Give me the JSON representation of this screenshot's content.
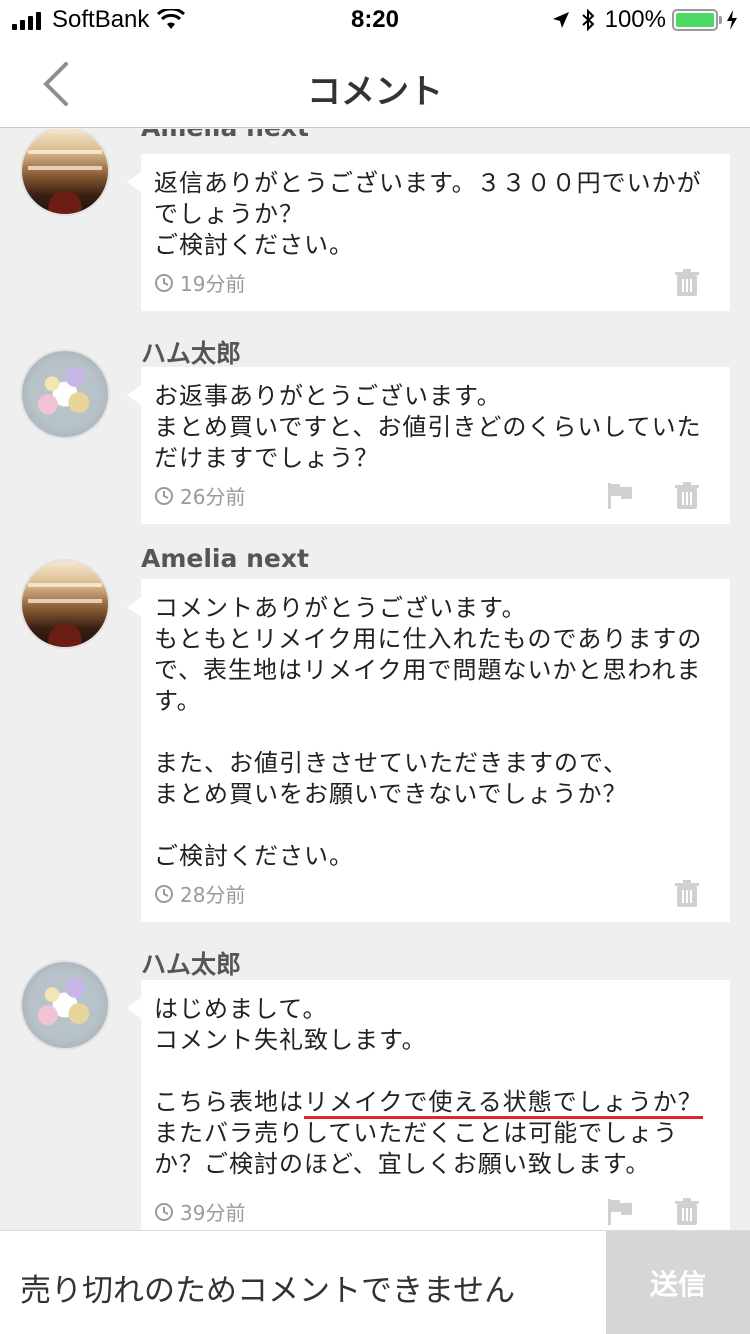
{
  "status_bar": {
    "carrier": "SoftBank",
    "time": "8:20",
    "battery": "100%"
  },
  "nav": {
    "title": "コメント"
  },
  "comments": [
    {
      "author": "Amelia next",
      "avatar": "store-interior",
      "body": "返信ありがとうございます。３３００円でいかがでしょうか？\nご検討ください。",
      "time": "19分前",
      "has_flag": false
    },
    {
      "author": "ハム太郎",
      "avatar": "flower-bouquet",
      "body": "お返事ありがとうございます。\nまとめ買いですと、お値引きどのくらいしていただけますでしょう？",
      "time": "26分前",
      "has_flag": true
    },
    {
      "author": "Amelia next",
      "avatar": "store-interior",
      "body": "コメントありがとうございます。\nもともとリメイク用に仕入れたものでありますので、表生地はリメイク用で問題ないかと思われます。\n\nまた、お値引きさせていただきますので、\nまとめ買いをお願いできないでしょうか？\n\nご検討ください。",
      "time": "28分前",
      "has_flag": false
    },
    {
      "author": "ハム太郎",
      "avatar": "flower-bouquet",
      "body_parts": {
        "before": "はじめまして。\nコメント失礼致します。\n\nこちら表地は",
        "underlined": "リメイクで使える状態でしょうか？",
        "after": "またバラ売りしていただくことは可能でしょうか？ご検討のほど、宜しくお願い致します。"
      },
      "time": "39分前",
      "has_flag": true
    }
  ],
  "footer": {
    "message": "売り切れのためコメントできません",
    "send_label": "送信"
  },
  "colors": {
    "underline": "#e0252f",
    "send_disabled": "#d6d6d6",
    "battery": "#4cd964"
  }
}
